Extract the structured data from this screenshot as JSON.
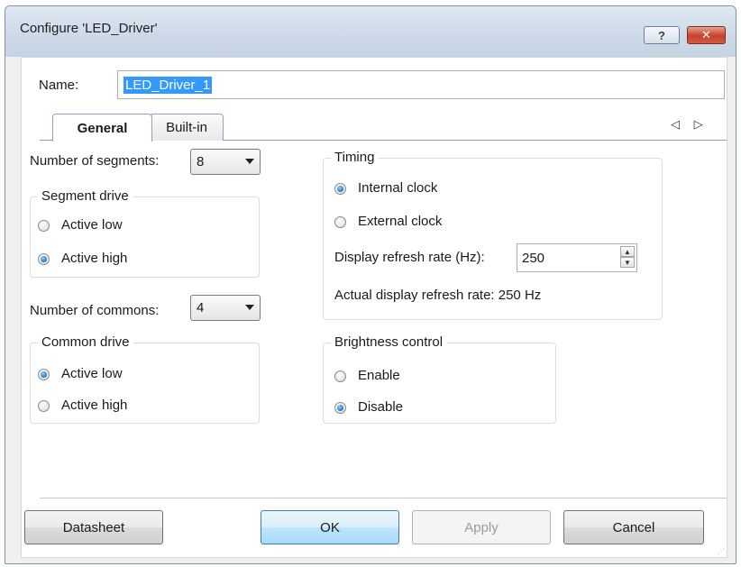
{
  "window": {
    "title": "Configure 'LED_Driver'",
    "help_label": "?",
    "close_label": "✕"
  },
  "name": {
    "label": "Name:",
    "value": "LED_Driver_1"
  },
  "tabs": [
    {
      "label": "General",
      "active": true
    },
    {
      "label": "Built-in",
      "active": false
    }
  ],
  "tab_scroll_arrows": "◁ ▷",
  "segments": {
    "label": "Number of segments:",
    "value": "8",
    "drive": {
      "title": "Segment drive",
      "options": [
        {
          "label": "Active low",
          "checked": false
        },
        {
          "label": "Active high",
          "checked": true
        }
      ]
    }
  },
  "commons": {
    "label": "Number of commons:",
    "value": "4",
    "drive": {
      "title": "Common drive",
      "options": [
        {
          "label": "Active low",
          "checked": true
        },
        {
          "label": "Active high",
          "checked": false
        }
      ]
    }
  },
  "timing": {
    "title": "Timing",
    "options": [
      {
        "label": "Internal clock",
        "checked": true
      },
      {
        "label": "External clock",
        "checked": false
      }
    ],
    "refresh_label": "Display refresh rate (Hz):",
    "refresh_value": "250",
    "actual_label": "Actual display refresh rate: 250 Hz"
  },
  "brightness": {
    "title": "Brightness control",
    "options": [
      {
        "label": "Enable",
        "checked": false
      },
      {
        "label": "Disable",
        "checked": true
      }
    ]
  },
  "buttons": {
    "datasheet": "Datasheet",
    "ok": "OK",
    "apply": "Apply",
    "cancel": "Cancel"
  },
  "colors": {
    "selection": "#3399ff",
    "close_button": "#c4422a",
    "radio_selected": "#1a74c4"
  }
}
